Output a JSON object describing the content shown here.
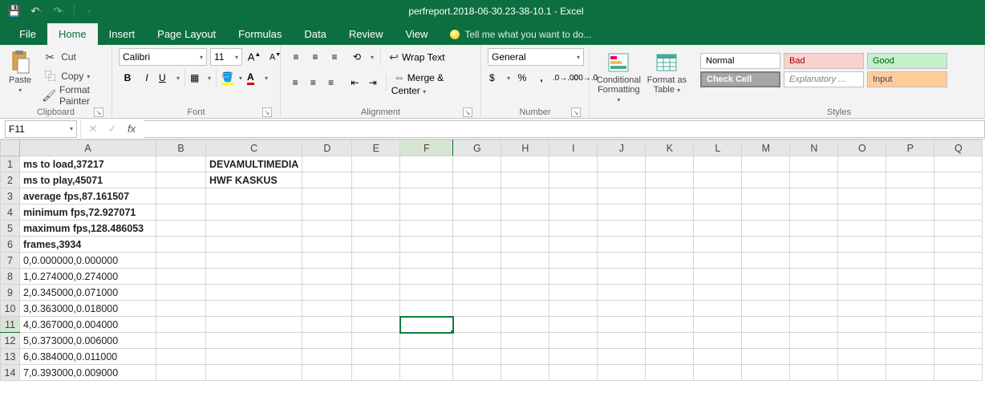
{
  "title": "perfreport.2018-06-30.23-38-10.1 - Excel",
  "tabs": {
    "file": "File",
    "home": "Home",
    "insert": "Insert",
    "pagelayout": "Page Layout",
    "formulas": "Formulas",
    "data": "Data",
    "review": "Review",
    "view": "View",
    "tellme": "Tell me what you want to do..."
  },
  "ribbon": {
    "clipboard": {
      "label": "Clipboard",
      "paste": "Paste",
      "cut": "Cut",
      "copy": "Copy",
      "fpainter": "Format Painter"
    },
    "font": {
      "label": "Font",
      "name": "Calibri",
      "size": "11"
    },
    "alignment": {
      "label": "Alignment",
      "wrap": "Wrap Text",
      "merge": "Merge & Center"
    },
    "number": {
      "label": "Number",
      "format": "General"
    },
    "cond": "Conditional Formatting",
    "fat": "Format as Table",
    "styles": {
      "label": "Styles",
      "normal": "Normal",
      "bad": "Bad",
      "good": "Good",
      "check": "Check Cell",
      "expl": "Explanatory ...",
      "input": "Input"
    }
  },
  "namebox": "F11",
  "formula": "",
  "cols": [
    "A",
    "B",
    "C",
    "D",
    "E",
    "F",
    "G",
    "H",
    "I",
    "J",
    "K",
    "L",
    "M",
    "N",
    "O",
    "P",
    "Q"
  ],
  "rows": [
    {
      "n": 1,
      "bold": true,
      "A": "ms to load,37217",
      "C": "DEVAMULTIMEDIA"
    },
    {
      "n": 2,
      "bold": true,
      "A": "ms to play,45071",
      "C": "HWF KASKUS"
    },
    {
      "n": 3,
      "bold": true,
      "A": "average fps,87.161507"
    },
    {
      "n": 4,
      "bold": true,
      "A": "minimum fps,72.927071"
    },
    {
      "n": 5,
      "bold": true,
      "A": "maximum fps,128.486053"
    },
    {
      "n": 6,
      "bold": true,
      "A": "frames,3934"
    },
    {
      "n": 7,
      "A": "0,0.000000,0.000000"
    },
    {
      "n": 8,
      "A": "1,0.274000,0.274000"
    },
    {
      "n": 9,
      "A": "2,0.345000,0.071000"
    },
    {
      "n": 10,
      "A": "3,0.363000,0.018000"
    },
    {
      "n": 11,
      "A": "4,0.367000,0.004000",
      "activeRow": true
    },
    {
      "n": 12,
      "A": "5,0.373000,0.006000"
    },
    {
      "n": 13,
      "A": "6,0.384000,0.011000"
    },
    {
      "n": 14,
      "A": "7,0.393000,0.009000"
    }
  ],
  "activeCell": {
    "row": 11,
    "col": "F"
  }
}
